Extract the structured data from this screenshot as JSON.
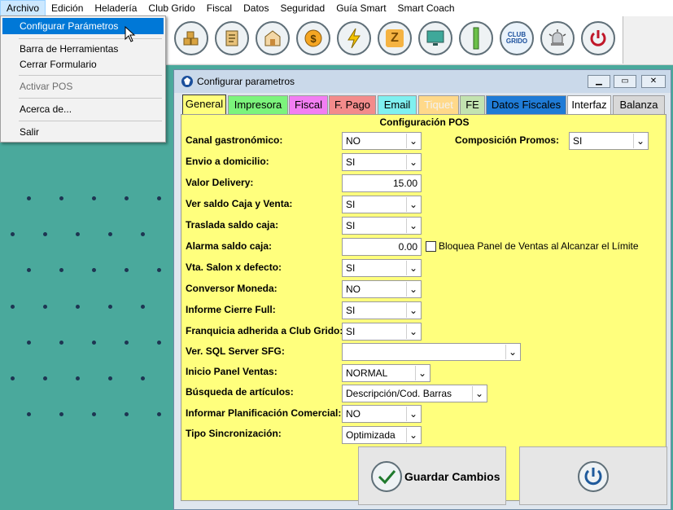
{
  "menubar": [
    "Archivo",
    "Edición",
    "Heladería",
    "Club Grido",
    "Fiscal",
    "Datos",
    "Seguridad",
    "Guía Smart",
    "Smart Coach"
  ],
  "dropdown": {
    "items": [
      "Configurar Parámetros",
      "Barra de Herramientas",
      "Cerrar Formulario",
      "Activar POS",
      "Acerca de...",
      "Salir"
    ]
  },
  "toolbar": {
    "icons": [
      "boxes-icon",
      "checklist-icon",
      "store-icon",
      "money-refresh-icon",
      "lightning-icon",
      "z-report-icon",
      "monitor-icon",
      "bar-icon",
      "club-grido-icon",
      "alarm-bell-icon",
      "power-icon"
    ],
    "club_label": "CLUB GRIDO",
    "z_label": "Z"
  },
  "window": {
    "title": "Configurar parametros",
    "tabs": [
      "General",
      "Impresora",
      "Fiscal",
      "F. Pago",
      "Email",
      "Tiquet",
      "FE",
      "Datos Fiscales",
      "Interfaz",
      "Balanza"
    ],
    "section_title": "Configuración POS",
    "fields": {
      "canal": {
        "label": "Canal gastronómico:",
        "value": "NO"
      },
      "composicion": {
        "label": "Composición Promos:",
        "value": "SI"
      },
      "envio": {
        "label": "Envio a domicilio:",
        "value": "SI"
      },
      "valor_delivery": {
        "label": "Valor Delivery:",
        "value": "15.00"
      },
      "ver_saldo": {
        "label": "Ver saldo Caja y Venta:",
        "value": "SI"
      },
      "traslada": {
        "label": "Traslada saldo caja:",
        "value": "SI"
      },
      "alarma": {
        "label": "Alarma saldo caja:",
        "value": "0.00"
      },
      "bloquea": {
        "label": "Bloquea Panel de Ventas al Alcanzar el Límite"
      },
      "vta_salon": {
        "label": "Vta. Salon x defecto:",
        "value": "SI"
      },
      "conversor": {
        "label": "Conversor Moneda:",
        "value": "NO"
      },
      "informe": {
        "label": "Informe Cierre Full:",
        "value": "SI"
      },
      "franquicia": {
        "label": "Franquicia adherida a Club Grido:",
        "value": "SI"
      },
      "sql": {
        "label": "Ver. SQL Server SFG:",
        "value": ""
      },
      "inicio": {
        "label": "Inicio Panel Ventas:",
        "value": "NORMAL"
      },
      "busqueda": {
        "label": "Búsqueda de artículos:",
        "value": "Descripción/Cod. Barras"
      },
      "planificacion": {
        "label": "Informar Planificación Comercial:",
        "value": "NO"
      },
      "sincronizacion": {
        "label": "Tipo Sincronización:",
        "value": "Optimizada"
      }
    },
    "save_button": "Guardar Cambios"
  },
  "colors": {
    "desktop": "#4aa99c",
    "panel": "#ffff7d",
    "tab_impresora": "#7cf47c",
    "tab_fiscal": "#f27ef2",
    "tab_fpago": "#f38b8b",
    "tab_email": "#7ff0f0",
    "tab_tiquet": "#ffd98a",
    "tab_fe": "#c3e3b0",
    "tab_datos": "#1f7bd6",
    "tab_balanza": "#d8d8d8"
  }
}
